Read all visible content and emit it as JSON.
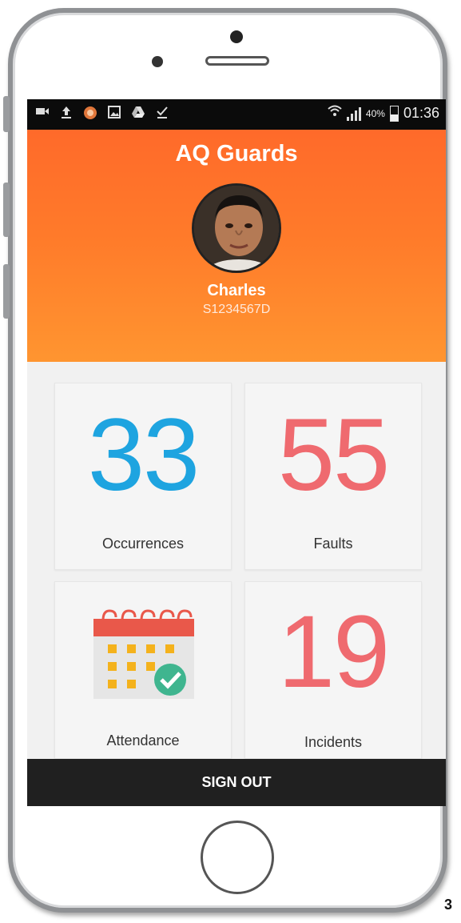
{
  "status_bar": {
    "battery_percent": "40%",
    "time": "01:36"
  },
  "header": {
    "app_title": "AQ Guards",
    "user_name": "Charles",
    "user_id": "S1234567D"
  },
  "dashboard": {
    "occurrences": {
      "count": "33",
      "label": "Occurrences",
      "color": "#1ea4e0"
    },
    "faults": {
      "count": "55",
      "label": "Faults",
      "color": "#ef6a6f"
    },
    "attendance": {
      "label": "Attendance",
      "icon": "calendar-check-icon"
    },
    "incidents": {
      "count": "19",
      "label": "Incidents",
      "color": "#ef6a6f"
    }
  },
  "footer": {
    "sign_out_label": "SIGN OUT"
  },
  "colors": {
    "header_start": "#ff6a2a",
    "header_end": "#ff9530",
    "calendar_red": "#e9584a",
    "calendar_yellow": "#f4b21c",
    "check_green": "#3fb58f"
  },
  "corner_text": "3"
}
